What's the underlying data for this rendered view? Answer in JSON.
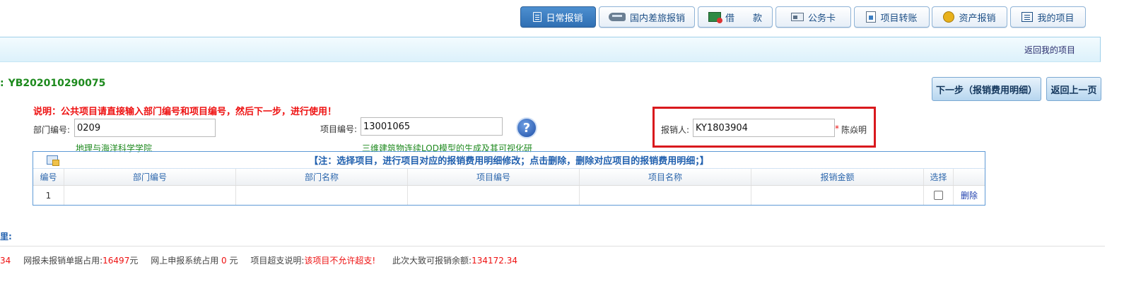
{
  "nav": [
    {
      "label": "日常报销",
      "icon": "document-icon",
      "active": true
    },
    {
      "label": "国内差旅报销",
      "icon": "train-icon",
      "active": false
    },
    {
      "label": "借　　款",
      "icon": "loan-icon",
      "active": false
    },
    {
      "label": "公务卡",
      "icon": "card-icon",
      "active": false
    },
    {
      "label": "项目转账",
      "icon": "transfer-icon",
      "active": false
    },
    {
      "label": "资产报销",
      "icon": "coins-icon",
      "active": false
    },
    {
      "label": "我的项目",
      "icon": "list-icon",
      "active": false
    }
  ],
  "back_link": "返回我的项目",
  "ref": {
    "colon": ":",
    "number": "YB202010290075"
  },
  "buttons": {
    "next": "下一步（报销费用明细）",
    "prev": "返回上一页"
  },
  "notice": "说明：公共项目请直接输入部门编号和项目编号，然后下一步，进行使用！",
  "form": {
    "dept_label": "部门编号:",
    "dept_value": "0209",
    "dept_name": "地理与海洋科学学院",
    "proj_label": "项目编号:",
    "proj_value": "13001065",
    "proj_name": "三维建筑物连续LOD模型的生成及其可视化研",
    "help": "?",
    "claimant_label": "报销人:",
    "claimant_value": "KY1803904",
    "claimant_required": "*",
    "claimant_name": "陈焱明"
  },
  "table": {
    "title": "【注：选择项目，进行项目对应的报销费用明细修改；点击删除，删除对应项目的报销费用明细；】",
    "headers": [
      "编号",
      "部门编号",
      "部门名称",
      "项目编号",
      "项目名称",
      "报销金额",
      "选择",
      ""
    ],
    "rows": [
      {
        "no": "1",
        "dept_no": "",
        "dept_name": "",
        "proj_no": "",
        "proj_name": "",
        "amount": "",
        "delete": "删除"
      }
    ]
  },
  "detail_label": "里:",
  "footer": {
    "lead": "34",
    "unreported_label": "网报未报销单据占用:",
    "unreported_value": "16497",
    "unreported_unit": "元",
    "online_label": "网上申报系统占用",
    "online_value": "0",
    "online_unit": "元",
    "overrun_label": "项目超支说明:",
    "overrun_value": "该项目不允许超支!",
    "balance_label": "此次大致可报销余额:",
    "balance_value": "134172.34"
  },
  "colors": {
    "accent": "#2f6fb3",
    "warning": "#e11111",
    "green": "#1d8a1d",
    "highlight": "#d9191d"
  }
}
